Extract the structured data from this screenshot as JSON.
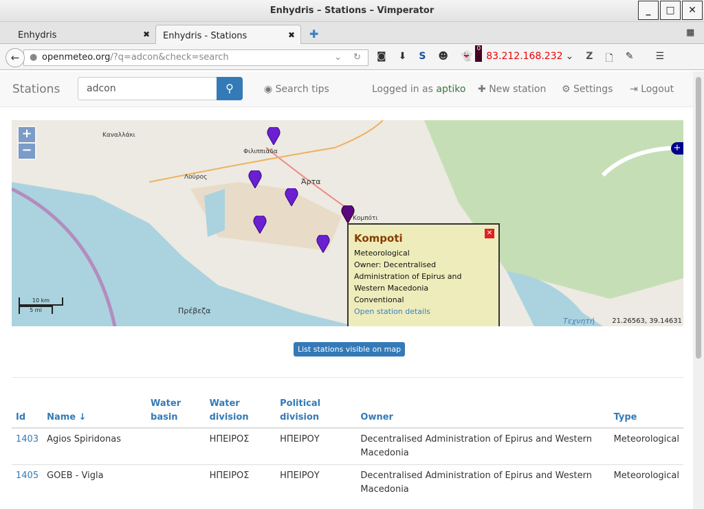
{
  "window": {
    "title": "Enhydris – Stations – Vimperator"
  },
  "tabs": [
    {
      "label": "Enhydris"
    },
    {
      "label": "Enhydris - Stations"
    }
  ],
  "address": {
    "host": "openmeteo.org",
    "path": "/?q=adcon&check=search"
  },
  "toolbar": {
    "ip": "83.212.168.232",
    "badge": "0"
  },
  "header": {
    "brand": "Stations",
    "search_value": "adcon",
    "search_tips": "Search tips",
    "logged_in_prefix": "Logged in as",
    "user": "aptiko",
    "new_station": "New station",
    "settings": "Settings",
    "logout": "Logout"
  },
  "map": {
    "places": [
      "Καναλλάκι",
      "Φιλιππιάδα",
      "Λούρος",
      "Άρτα",
      "Κομπότι",
      "Πρέβεζα",
      "Τεχνητή"
    ],
    "scale_km": "10 km",
    "scale_mi": "5 mi",
    "coords": "21.26563, 39.14631",
    "popup": {
      "title": "Kompoti",
      "lines": [
        "Meteorological",
        "Owner: Decentralised",
        "Administration of Epirus and",
        "Western Macedonia",
        "Conventional"
      ],
      "link": "Open station details"
    }
  },
  "list_button": "List stations visible on map",
  "table": {
    "headers": [
      "Id",
      "Name ↓",
      "Water basin",
      "Water division",
      "Political division",
      "Owner",
      "Type"
    ],
    "rows": [
      [
        "1403",
        "Agios Spiridonas",
        "",
        "ΗΠΕΙΡΟΣ",
        "ΗΠΕΙΡΟΥ",
        "Decentralised Administration of Epirus and Western Macedonia",
        "Meteorological"
      ],
      [
        "1405",
        "GOEB - Vigla",
        "",
        "ΗΠΕΙΡΟΣ",
        "ΗΠΕΙΡΟΥ",
        "Decentralised Administration of Epirus and Western Macedonia",
        "Meteorological"
      ]
    ]
  }
}
